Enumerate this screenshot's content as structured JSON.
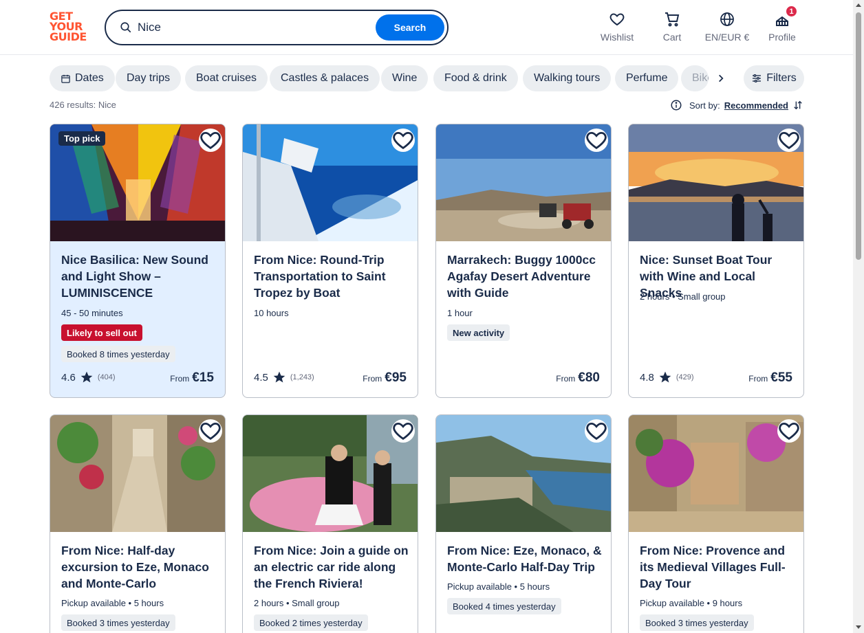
{
  "logo": {
    "line1": "GET",
    "line2": "YOUR",
    "line3": "GUIDE"
  },
  "search": {
    "value": "Nice",
    "button": "Search"
  },
  "nav": {
    "wishlist": "Wishlist",
    "cart": "Cart",
    "language": "EN/EUR €",
    "profile": "Profile",
    "profile_badge": "1"
  },
  "chips": [
    "Dates",
    "Day trips",
    "Boat cruises",
    "Castles & palaces",
    "Wine",
    "Food & drink",
    "Walking tours",
    "Perfume",
    "Bike"
  ],
  "filters_label": "Filters",
  "results_text": "426 results: Nice",
  "sort": {
    "label": "Sort by:",
    "value": "Recommended"
  },
  "common": {
    "from_label": "From",
    "top_pick": "Top pick"
  },
  "cards": [
    {
      "title": "Nice Basilica: New Sound and Light Show – LUMINISCENCE",
      "meta": "45 - 50 minutes",
      "tag1": "Likely to sell out",
      "tag2": "Booked 8 times yesterday",
      "rating": "4.6",
      "count": "(404)",
      "price": "€15"
    },
    {
      "title": "From Nice: Round-Trip Transportation to Saint Tropez by Boat",
      "meta": "10 hours",
      "rating": "4.5",
      "count": "(1,243)",
      "price": "€95"
    },
    {
      "title": "Marrakech: Buggy 1000cc Agafay Desert Adventure with Guide",
      "meta": "1 hour",
      "tag1": "New activity",
      "price": "€80"
    },
    {
      "title": "Nice: Sunset Boat Tour with Wine and Local Snacks",
      "meta": "2 hours • Small group",
      "rating": "4.8",
      "count": "(429)",
      "price": "€55"
    },
    {
      "title": "From Nice: Half-day excursion to Eze, Monaco and Monte-Carlo",
      "meta": "Pickup available • 5 hours",
      "tag1": "Booked 3 times yesterday"
    },
    {
      "title": "From Nice: Join a guide on an electric car ride along the French Riviera!",
      "meta": "2 hours • Small group",
      "tag1": "Booked 2 times yesterday"
    },
    {
      "title": "From Nice: Eze, Monaco, & Monte-Carlo Half-Day Trip",
      "meta": "Pickup available • 5 hours",
      "tag1": "Booked 4 times yesterday"
    },
    {
      "title": "From Nice: Provence and its Medieval Villages Full-Day Tour",
      "meta": "Pickup available • 9 hours",
      "tag1": "Booked 3 times yesterday"
    }
  ],
  "colors": {
    "brand": "#ff5533",
    "primary": "#0071eb",
    "text": "#1a2b49",
    "sellout": "#c8102e",
    "highlight_card": "#e2efff"
  }
}
